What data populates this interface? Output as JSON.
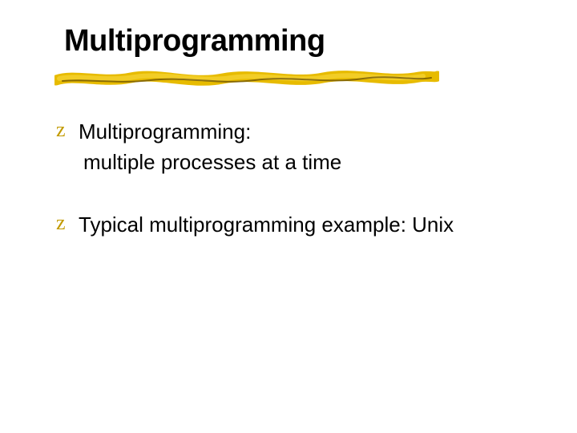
{
  "title": "Multiprogramming",
  "bullets": [
    {
      "mark": "z",
      "line1": "Multiprogramming:",
      "line2": "multiple processes at a time"
    },
    {
      "mark": "z",
      "line1": "Typical multiprogramming example: Unix",
      "line2": ""
    }
  ],
  "colors": {
    "accent": "#e0b400"
  }
}
